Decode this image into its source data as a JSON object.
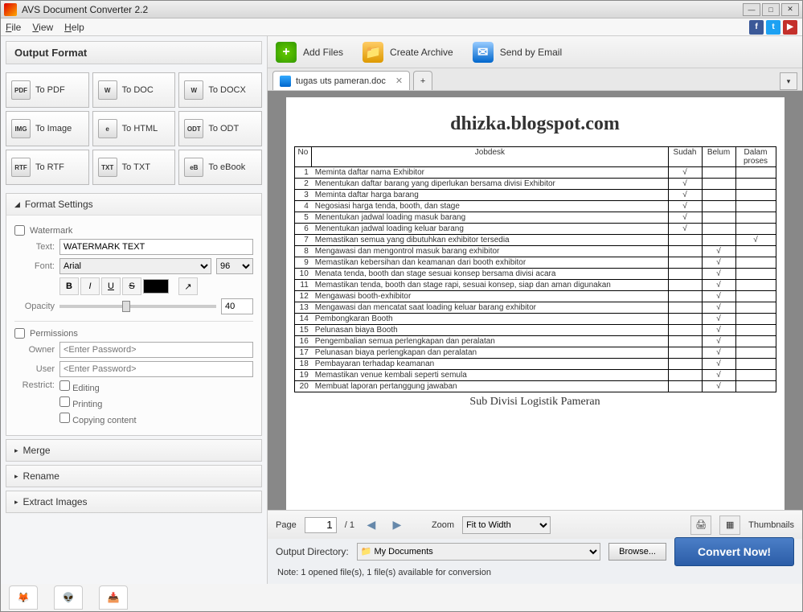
{
  "window": {
    "title": "AVS Document Converter 2.2"
  },
  "menu": {
    "file": "File",
    "view": "View",
    "help": "Help"
  },
  "left": {
    "header": "Output Format",
    "formats": [
      {
        "label": "To PDF",
        "ico": "PDF"
      },
      {
        "label": "To DOC",
        "ico": "W"
      },
      {
        "label": "To DOCX",
        "ico": "W"
      },
      {
        "label": "To Image",
        "ico": "IMG"
      },
      {
        "label": "To HTML",
        "ico": "e"
      },
      {
        "label": "To ODT",
        "ico": "ODT"
      },
      {
        "label": "To RTF",
        "ico": "RTF"
      },
      {
        "label": "To TXT",
        "ico": "TXT"
      },
      {
        "label": "To eBook",
        "ico": "eB"
      }
    ],
    "format_settings": "Format Settings",
    "watermark": {
      "chk": "Watermark",
      "text_lbl": "Text:",
      "text_val": "WATERMARK TEXT",
      "font_lbl": "Font:",
      "font_val": "Arial",
      "size_val": "96",
      "opacity_lbl": "Opacity",
      "opacity_val": "40"
    },
    "permissions": {
      "chk": "Permissions",
      "owner_lbl": "Owner",
      "owner_ph": "<Enter Password>",
      "user_lbl": "User",
      "user_ph": "<Enter Password>",
      "restrict_lbl": "Restrict:",
      "editing": "Editing",
      "printing": "Printing",
      "copying": "Copying content"
    },
    "merge": "Merge",
    "rename": "Rename",
    "extract": "Extract Images"
  },
  "toolbar": {
    "add": "Add Files",
    "archive": "Create Archive",
    "email": "Send by Email"
  },
  "tab": {
    "name": "tugas uts pameran.doc"
  },
  "doc": {
    "blog": "dhizka.blogspot.com",
    "headers": {
      "no": "No",
      "job": "Jobdesk",
      "sudah": "Sudah",
      "belum": "Belum",
      "dalam": "Dalam proses"
    },
    "rows": [
      {
        "n": "1",
        "d": "Meminta daftar nama Exhibitor",
        "s": "√",
        "b": "",
        "p": ""
      },
      {
        "n": "2",
        "d": "Menentukan daftar barang yang diperlukan bersama divisi Exhibitor",
        "s": "√",
        "b": "",
        "p": ""
      },
      {
        "n": "3",
        "d": "Meminta daftar harga barang",
        "s": "√",
        "b": "",
        "p": ""
      },
      {
        "n": "4",
        "d": "Negosiasi harga tenda, booth, dan stage",
        "s": "√",
        "b": "",
        "p": ""
      },
      {
        "n": "5",
        "d": "Menentukan jadwal loading masuk barang",
        "s": "√",
        "b": "",
        "p": ""
      },
      {
        "n": "6",
        "d": "Menentukan jadwal loading keluar barang",
        "s": "√",
        "b": "",
        "p": ""
      },
      {
        "n": "7",
        "d": "Memastikan semua yang dibutuhkan exhibitor tersedia",
        "s": "",
        "b": "",
        "p": "√"
      },
      {
        "n": "8",
        "d": "Mengawasi dan mengontrol masuk barang exhibitor",
        "s": "",
        "b": "√",
        "p": ""
      },
      {
        "n": "9",
        "d": "Memastikan kebersihan dan keamanan dari booth exhibitor",
        "s": "",
        "b": "√",
        "p": ""
      },
      {
        "n": "10",
        "d": "Menata tenda, booth dan stage sesuai konsep bersama divisi acara",
        "s": "",
        "b": "√",
        "p": ""
      },
      {
        "n": "11",
        "d": "Memastikan tenda, booth dan stage rapi, sesuai konsep, siap dan aman digunakan",
        "s": "",
        "b": "√",
        "p": ""
      },
      {
        "n": "12",
        "d": "Mengawasi booth-exhibitor",
        "s": "",
        "b": "√",
        "p": ""
      },
      {
        "n": "13",
        "d": "Mengawasi dan mencatat saat loading keluar barang exhibitor",
        "s": "",
        "b": "√",
        "p": ""
      },
      {
        "n": "14",
        "d": "Pembongkaran Booth",
        "s": "",
        "b": "√",
        "p": ""
      },
      {
        "n": "15",
        "d": "Pelunasan biaya Booth",
        "s": "",
        "b": "√",
        "p": ""
      },
      {
        "n": "16",
        "d": "Pengembalian semua perlengkapan dan peralatan",
        "s": "",
        "b": "√",
        "p": ""
      },
      {
        "n": "17",
        "d": "Pelunasan biaya perlengkapan dan peralatan",
        "s": "",
        "b": "√",
        "p": ""
      },
      {
        "n": "18",
        "d": "Pembayaran terhadap keamanan",
        "s": "",
        "b": "√",
        "p": ""
      },
      {
        "n": "19",
        "d": "Memastikan venue kembali seperti semula",
        "s": "",
        "b": "√",
        "p": ""
      },
      {
        "n": "20",
        "d": "Membuat laporan pertanggung jawaban",
        "s": "",
        "b": "√",
        "p": ""
      }
    ],
    "caption": "Sub Divisi Logistik Pameran"
  },
  "pager": {
    "page_lbl": "Page",
    "page_val": "1",
    "page_total": "/ 1",
    "zoom_lbl": "Zoom",
    "zoom_val": "Fit to Width",
    "thumbs": "Thumbnails"
  },
  "output": {
    "dir_lbl": "Output Directory:",
    "dir_val": "My Documents",
    "browse": "Browse...",
    "convert": "Convert Now!",
    "note": "Note: 1 opened file(s), 1 file(s) available for conversion"
  }
}
